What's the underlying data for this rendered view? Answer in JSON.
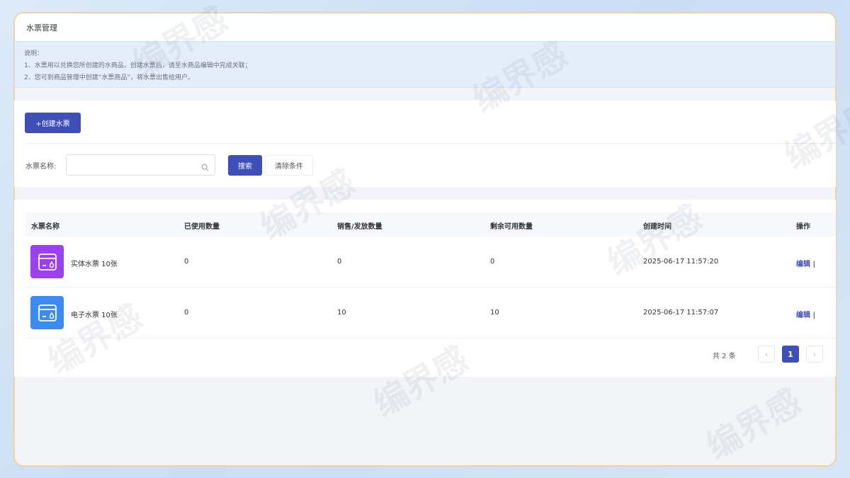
{
  "header": {
    "title": "水票管理"
  },
  "notice": {
    "heading": "说明：",
    "line1": "1、水票用以兑换您所创建的水商品，创建水票后，请至水商品编辑中完成关联；",
    "line2": "2、您可到商品管理中创建“水票商品”，将水票出售给用户。"
  },
  "toolbar": {
    "create_label": "+创建水票"
  },
  "search": {
    "label": "水票名称:",
    "placeholder": "",
    "search_label": "搜索",
    "clear_label": "清除条件"
  },
  "table": {
    "columns": [
      "水票名称",
      "已使用数量",
      "销售/发放数量",
      "剩余可用数量",
      "创建时间",
      "操作"
    ],
    "rows": [
      {
        "name": "实体水票 10张",
        "used": "0",
        "sold": "0",
        "remaining": "0",
        "created": "2025-06-17 11:57:20",
        "action": "编辑 |",
        "icon_color": "#9b3ff0",
        "icon": "ticket-icon"
      },
      {
        "name": "电子水票 10张",
        "used": "0",
        "sold": "10",
        "remaining": "10",
        "created": "2025-06-17 11:57:07",
        "action": "编辑 |",
        "icon_color": "#3b8cf0",
        "icon": "ticket-icon"
      }
    ]
  },
  "pagination": {
    "total": "共 2 条",
    "prev": "‹",
    "current": "1",
    "next": "›"
  },
  "watermark": "编界感"
}
